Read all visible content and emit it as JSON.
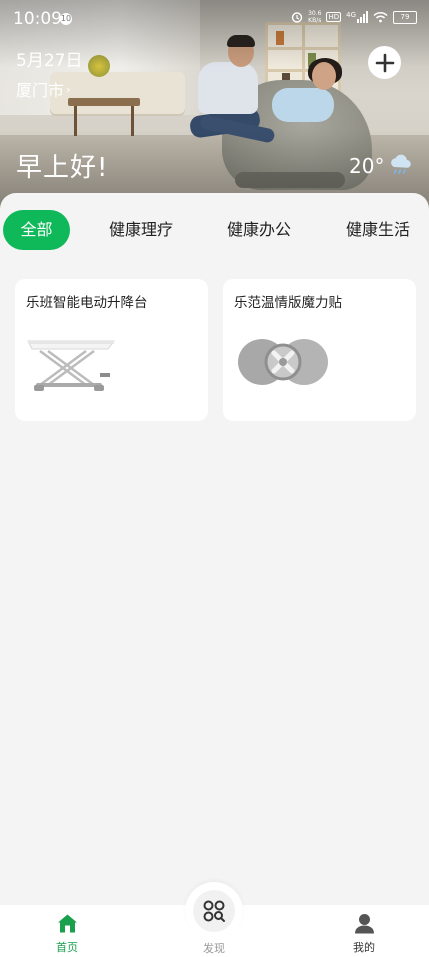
{
  "status_bar": {
    "time": "10:09",
    "notification_badge": "10",
    "net_speed_value": "30.6",
    "net_speed_unit": "KB/s",
    "hd_label": "HD",
    "network_type": "4G",
    "battery": "79"
  },
  "header": {
    "date": "5月27日",
    "city": "厦门市",
    "greeting": "早上好!",
    "temperature": "20°",
    "weather_icon": "rain-cloud-icon"
  },
  "tabs": [
    {
      "label": "全部",
      "active": true
    },
    {
      "label": "健康理疗",
      "active": false
    },
    {
      "label": "健康办公",
      "active": false
    },
    {
      "label": "健康生活",
      "active": false
    }
  ],
  "devices": [
    {
      "name": "乐班智能电动升降台",
      "image": "lift-desk-image"
    },
    {
      "name": "乐范温情版魔力贴",
      "image": "magic-patch-image"
    }
  ],
  "bottom_nav": {
    "home": {
      "label": "首页",
      "icon": "home-icon"
    },
    "discover": {
      "label": "发现",
      "icon": "discover-icon"
    },
    "mine": {
      "label": "我的",
      "icon": "user-icon"
    }
  },
  "colors": {
    "accent": "#0fb95a",
    "nav_active": "#1aa04d",
    "background": "#f4f4f4"
  }
}
